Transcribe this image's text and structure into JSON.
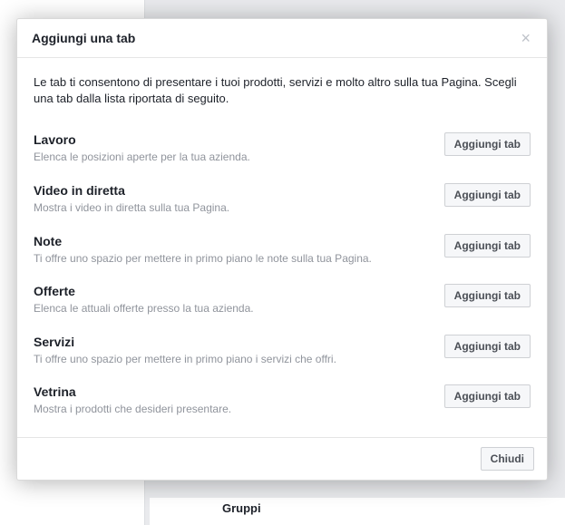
{
  "modal": {
    "title": "Aggiungi una tab",
    "intro": "Le tab ti consentono di presentare i tuoi prodotti, servizi e molto altro sulla tua Pagina. Scegli una tab dalla lista riportata di seguito.",
    "add_button_label": "Aggiungi tab",
    "close_button_label": "Chiudi",
    "tabs": [
      {
        "name": "Lavoro",
        "desc": "Elenca le posizioni aperte per la tua azienda."
      },
      {
        "name": "Video in diretta",
        "desc": "Mostra i video in diretta sulla tua Pagina."
      },
      {
        "name": "Note",
        "desc": "Ti offre uno spazio per mettere in primo piano le note sulla tua Pagina."
      },
      {
        "name": "Offerte",
        "desc": "Elenca le attuali offerte presso la tua azienda."
      },
      {
        "name": "Servizi",
        "desc": "Ti offre uno spazio per mettere in primo piano i servizi che offri."
      },
      {
        "name": "Vetrina",
        "desc": "Mostra i prodotti che desideri presentare."
      }
    ]
  },
  "background": {
    "bottom_label": "Gruppi"
  }
}
